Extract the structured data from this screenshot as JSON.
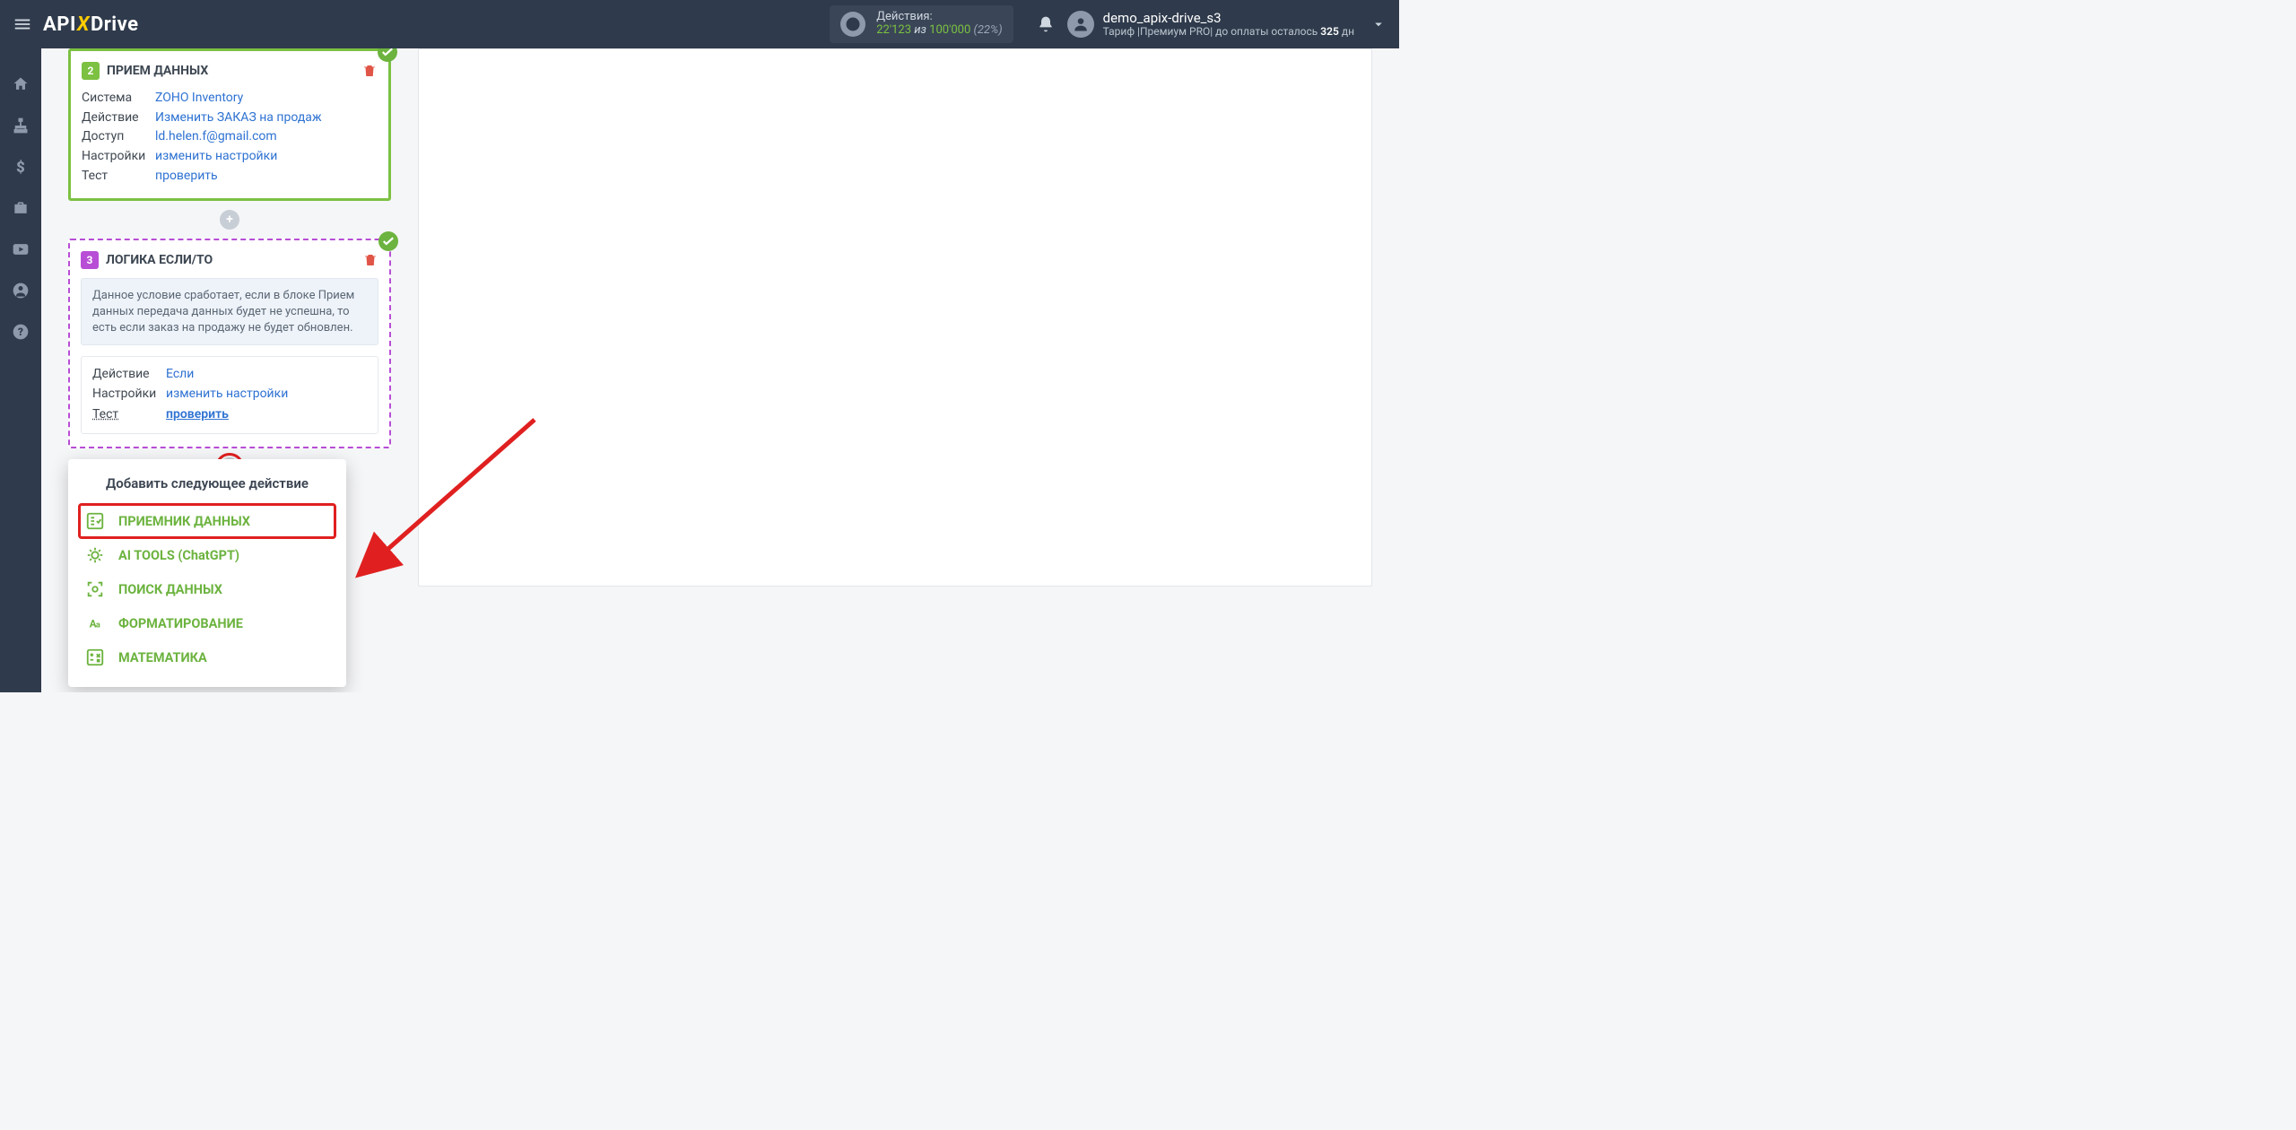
{
  "navbar": {
    "logo_api": "API",
    "logo_x": "X",
    "logo_drive": "Drive",
    "actions_label": "Действия:",
    "actions_used": "22'123",
    "actions_of": "из",
    "actions_total": "100'000",
    "actions_pct": "(22%)"
  },
  "user": {
    "name": "demo_apix-drive_s3",
    "plan_prefix": "Тариф |",
    "plan_name": "Премиум PRO",
    "pay_prefix": "| до оплаты осталось ",
    "pay_days": "325",
    "pay_suffix": " дн"
  },
  "card2": {
    "num": "2",
    "title": "ПРИЕМ ДАННЫХ",
    "k_system": "Система",
    "v_system": "ZOHO Inventory",
    "k_action": "Действие",
    "v_action": "Изменить ЗАКАЗ на продаж",
    "k_access": "Доступ",
    "v_access": "ld.helen.f@gmail.com",
    "k_settings": "Настройки",
    "v_settings": "изменить настройки",
    "k_test": "Тест",
    "v_test": "проверить"
  },
  "card3": {
    "num": "3",
    "title": "ЛОГИКА ЕСЛИ/ТО",
    "note": "Данное условие сработает, если в блоке Прием данных передача данных будет не успешна, то есть если заказ на продажу не будет обновлен.",
    "k_action": "Действие",
    "v_action": "Если",
    "k_settings": "Настройки",
    "v_settings": "изменить настройки",
    "k_test": "Тест",
    "v_test": "проверить"
  },
  "popup": {
    "title": "Добавить следующее действие",
    "items": [
      "ПРИЕМНИК ДАННЫХ",
      "AI TOOLS (ChatGPT)",
      "ПОИСК ДАННЫХ",
      "ФОРМАТИРОВАНИЕ",
      "МАТЕМАТИКА"
    ]
  }
}
